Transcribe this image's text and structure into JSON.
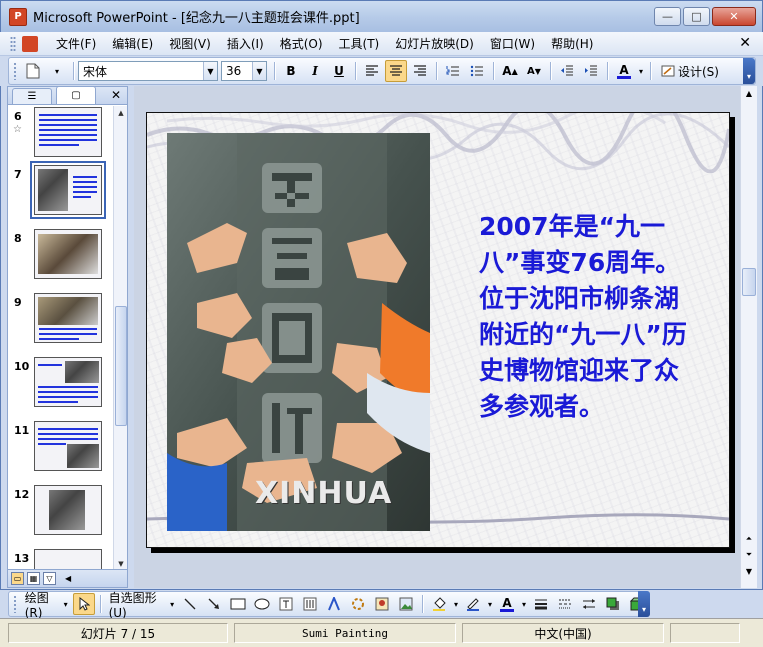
{
  "window": {
    "app_icon": "P",
    "title": "Microsoft PowerPoint - [纪念九一八主题班会课件.ppt]",
    "minimize": "—",
    "maximize": "□",
    "close": "✕"
  },
  "menu": {
    "items": [
      "文件(F)",
      "编辑(E)",
      "视图(V)",
      "插入(I)",
      "格式(O)",
      "工具(T)",
      "幻灯片放映(D)",
      "窗口(W)",
      "帮助(H)"
    ],
    "close": "✕"
  },
  "format_toolbar": {
    "font_name": "宋体",
    "font_size": "36",
    "bold": "B",
    "italic": "I",
    "underline": "U",
    "design_label": "设计(S)"
  },
  "left_pane": {
    "tab_outline": "☰",
    "tab_slides": "▢",
    "close": "✕",
    "slides": [
      {
        "number": "6",
        "star": "☆"
      },
      {
        "number": "7"
      },
      {
        "number": "8"
      },
      {
        "number": "9"
      },
      {
        "number": "10"
      },
      {
        "number": "11"
      },
      {
        "number": "12"
      },
      {
        "number": "13"
      }
    ]
  },
  "slide": {
    "photo_watermark": "XINHUA",
    "body_text": "2007年是“九一八”事变76周年。位于沈阳市柳条湖附近的“九一八”历史博物馆迎来了众多参观者。"
  },
  "draw_toolbar": {
    "draw_label": "绘图(R)",
    "autoshape_label": "自选图形(U)"
  },
  "status_bar": {
    "slide_position": "幻灯片 7 / 15",
    "design_name": "Sumi Painting",
    "language": "中文(中国)"
  },
  "colors": {
    "slide_text": "#1a1ad6",
    "selection_highlight": "#fbd88a",
    "title_bar": "#b5cae8"
  }
}
